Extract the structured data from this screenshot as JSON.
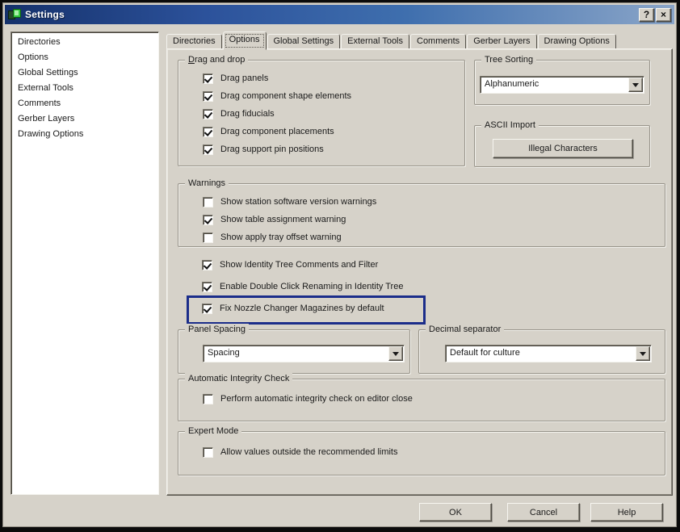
{
  "window": {
    "title": "Settings",
    "help_button": "?",
    "close_button": "×"
  },
  "colors": {
    "dialog_bg": "#d6d2c9",
    "titlebar_left": "#15316b",
    "titlebar_right": "#8aa5c8",
    "highlight_border": "#1b2d8a",
    "title_icon_green": "#35c93f"
  },
  "sidebar": {
    "items": [
      "Directories",
      "Options",
      "Global Settings",
      "External Tools",
      "Comments",
      "Gerber Layers",
      "Drawing Options"
    ]
  },
  "tabs": [
    {
      "label": "Directories",
      "selected": false
    },
    {
      "label": "Options",
      "selected": true
    },
    {
      "label": "Global Settings",
      "selected": false
    },
    {
      "label": "External Tools",
      "selected": false
    },
    {
      "label": "Comments",
      "selected": false
    },
    {
      "label": "Gerber Layers",
      "selected": false
    },
    {
      "label": "Drawing Options",
      "selected": false
    }
  ],
  "panel": {
    "drag_group": {
      "title": "Drag and drop",
      "items": [
        {
          "label": "Drag panels",
          "checked": true
        },
        {
          "label": "Drag component shape elements",
          "checked": true
        },
        {
          "label": "Drag fiducials",
          "checked": true
        },
        {
          "label": "Drag component placements",
          "checked": true
        },
        {
          "label": "Drag support pin positions",
          "checked": true
        }
      ]
    },
    "tree_sorting": {
      "title": "Tree Sorting",
      "value": "Alphanumeric"
    },
    "ascii_import": {
      "title": "ASCII Import",
      "button_label": "Illegal Characters"
    },
    "warnings": {
      "title": "Warnings",
      "items": [
        {
          "label": "Show station software version warnings",
          "checked": false
        },
        {
          "label": "Show table assignment warning",
          "checked": true
        },
        {
          "label": "Show apply tray offset warning",
          "checked": false
        }
      ]
    },
    "standalone": [
      {
        "label": "Show Identity Tree Comments and Filter",
        "checked": true,
        "highlight": false
      },
      {
        "label": "Enable Double Click Renaming in Identity Tree",
        "checked": true,
        "highlight": false
      },
      {
        "label": "Fix Nozzle Changer Magazines by default",
        "checked": true,
        "highlight": true
      }
    ],
    "panel_spacing": {
      "title": "Panel Spacing",
      "value": "Spacing"
    },
    "decimal_separator": {
      "title": "Decimal separator",
      "value": "Default for culture"
    },
    "integrity": {
      "title": "Automatic Integrity Check",
      "items": [
        {
          "label": "Perform automatic integrity check on editor close",
          "checked": false
        }
      ]
    },
    "expert": {
      "title": "Expert Mode",
      "items": [
        {
          "label": "Allow values outside the recommended limits",
          "checked": false
        }
      ]
    }
  },
  "footer": {
    "ok": "OK",
    "cancel": "Cancel",
    "help": "Help"
  }
}
